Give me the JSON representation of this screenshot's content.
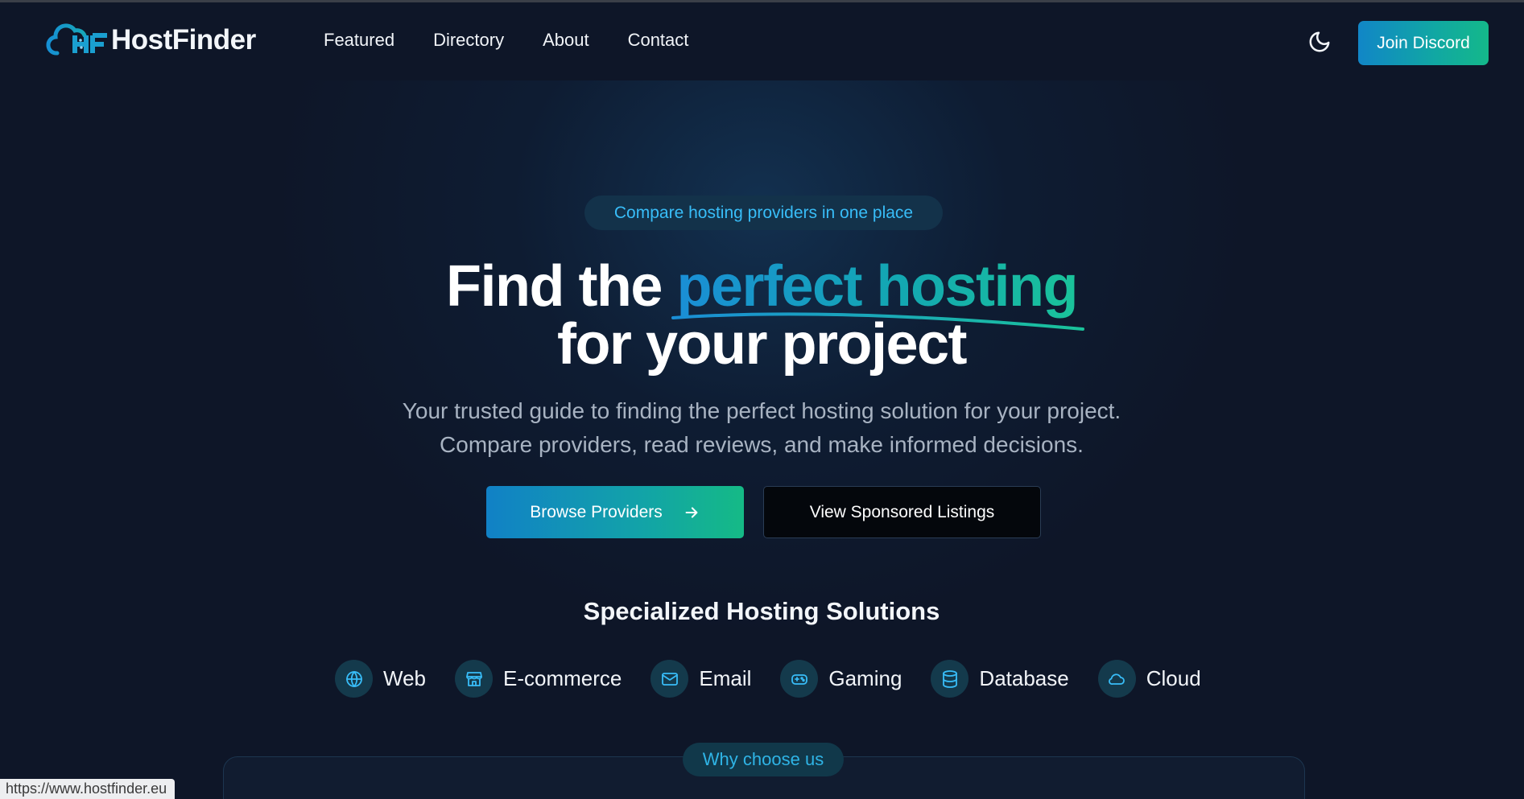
{
  "brand": {
    "logo_mark_icon": "cloud-hf-logo-icon",
    "name": "HostFinder"
  },
  "nav": {
    "links": [
      "Featured",
      "Directory",
      "About",
      "Contact"
    ],
    "theme_toggle_icon": "moon-icon",
    "cta": "Join Discord"
  },
  "hero": {
    "pill": "Compare hosting providers in one place",
    "headline_start": "Find the ",
    "headline_highlight": "perfect hosting",
    "headline_line2": "for your project",
    "subtitle_line1": "Your trusted guide to finding the perfect hosting solution for your project.",
    "subtitle_line2": "Compare providers, read reviews, and make informed decisions.",
    "primary_button": "Browse Providers",
    "primary_button_icon": "arrow-right-icon",
    "secondary_button": "View Sponsored Listings"
  },
  "solutions": {
    "title": "Specialized Hosting Solutions",
    "categories": [
      {
        "label": "Web",
        "icon": "globe-icon"
      },
      {
        "label": "E-commerce",
        "icon": "store-icon"
      },
      {
        "label": "Email",
        "icon": "mail-icon"
      },
      {
        "label": "Gaming",
        "icon": "gamepad-icon"
      },
      {
        "label": "Database",
        "icon": "database-icon"
      },
      {
        "label": "Cloud",
        "icon": "cloud-icon"
      }
    ]
  },
  "why": {
    "pill": "Why choose us"
  },
  "status_bar": {
    "url": "https://www.hostfinder.eu"
  },
  "colors": {
    "background": "#0e1628",
    "accent_blue": "#1a8ed6",
    "accent_green": "#1ac39a",
    "pill_text": "#38bdf8"
  }
}
